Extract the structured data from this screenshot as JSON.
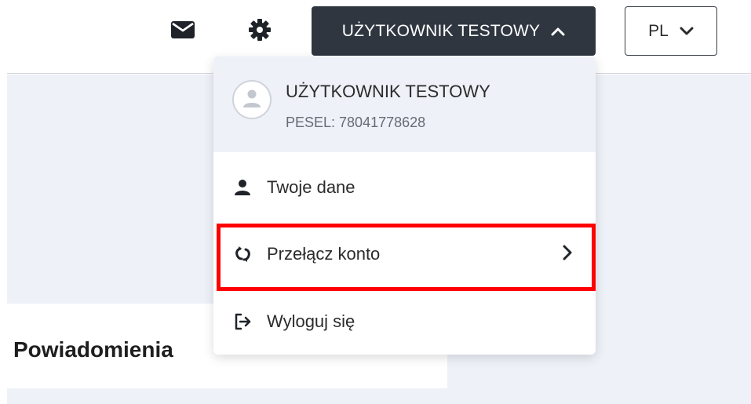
{
  "header": {
    "mail_icon": "envelope-icon",
    "settings_icon": "gear-icon",
    "user_button_label": "UŻYTKOWNIK TESTOWY",
    "language_label": "PL"
  },
  "main": {
    "section_title": "Powiadomienia"
  },
  "user_menu": {
    "name": "UŻYTKOWNIK TESTOWY",
    "pesel": "PESEL: 78041778628",
    "items": [
      {
        "label": "Twoje dane",
        "icon": "user-icon"
      },
      {
        "label": "Przełącz konto",
        "icon": "switch-account-icon"
      },
      {
        "label": "Wyloguj się",
        "icon": "logout-icon"
      }
    ]
  },
  "colors": {
    "user_button_bg": "#2f3640",
    "panel_bg": "#eef1f8",
    "highlight": "#ff0000"
  }
}
